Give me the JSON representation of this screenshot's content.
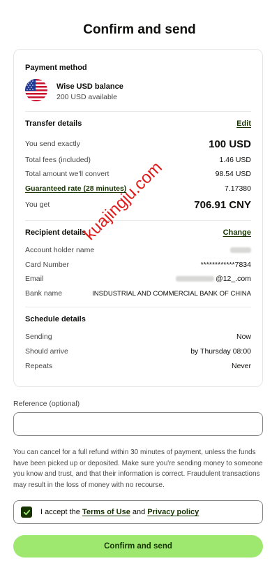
{
  "page": {
    "title": "Confirm and send"
  },
  "payment_method": {
    "title": "Payment method",
    "balance_name": "Wise USD balance",
    "balance_available": "200 USD available",
    "flag_icon": "us-flag-icon"
  },
  "transfer": {
    "title": "Transfer details",
    "edit_label": "Edit",
    "rows": [
      {
        "label": "You send exactly",
        "value": "100 USD"
      },
      {
        "label": "Total fees (included)",
        "value": "1.46 USD"
      },
      {
        "label": "Total amount we'll convert",
        "value": "98.54 USD"
      },
      {
        "label": "Guaranteed rate (28 minutes)",
        "value": "7.17380"
      },
      {
        "label": "You get",
        "value": "706.91 CNY"
      }
    ]
  },
  "recipient": {
    "title": "Recipient details",
    "change_label": "Change",
    "rows": [
      {
        "label": "Account holder name",
        "value": ""
      },
      {
        "label": "Card Number",
        "value": "************7834"
      },
      {
        "label": "Email",
        "value_suffix": "@12_.com"
      },
      {
        "label": "Bank name",
        "value": "INSDUSTRIAL AND COMMERCIAL BANK OF CHINA"
      }
    ]
  },
  "schedule": {
    "title": "Schedule details",
    "rows": [
      {
        "label": "Sending",
        "value": "Now"
      },
      {
        "label": "Should arrive",
        "value": "by Thursday 08:00"
      },
      {
        "label": "Repeats",
        "value": "Never"
      }
    ]
  },
  "watermark": "kuajingju.com",
  "reference": {
    "label": "Reference (optional)",
    "placeholder": "",
    "value": ""
  },
  "disclaimer": "You can cancel for a full refund within 30 minutes of payment, unless the funds have been picked up or deposited. Make sure you're sending money to someone you know and trust, and that their information is correct. Fraudulent transactions may result in the loss of money with no recourse.",
  "terms": {
    "prefix": "I accept the",
    "terms_link": "Terms of Use",
    "conjunction": "and",
    "privacy_link": "Privacy policy",
    "checked": true
  },
  "confirm_button": {
    "label": "Confirm and send"
  },
  "colors": {
    "accent_green": "#9fe870",
    "dark_green": "#163300",
    "watermark_red": "#e01b1b"
  }
}
